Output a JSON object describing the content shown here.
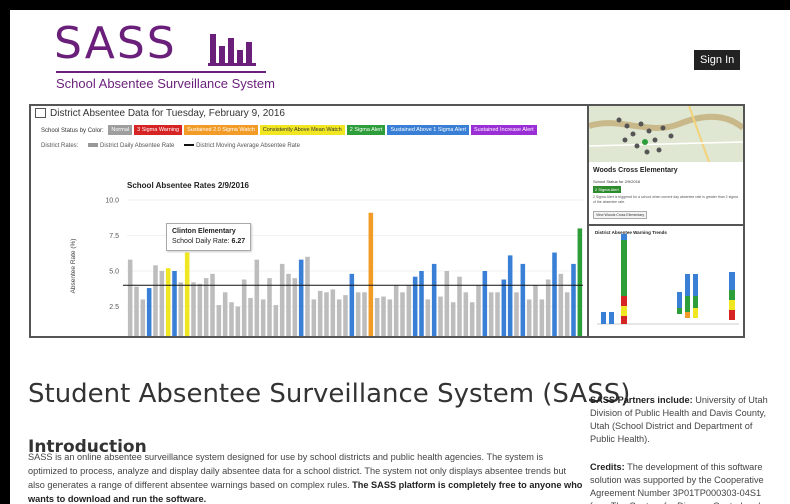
{
  "header": {
    "logo_word": "SASS",
    "logo_tagline": "School Absentee Surveillance System",
    "signin_label": "Sign In",
    "brand_color": "#6a1f7a"
  },
  "dashboard": {
    "title": "District Absentee Data for Tuesday, February 9, 2016",
    "status_label": "School Status by Color:",
    "statuses": [
      {
        "label": "Normal",
        "color": "#9e9e9e"
      },
      {
        "label": "3 Sigma Warning",
        "color": "#d62424"
      },
      {
        "label": "Sustained 2.0 Sigma Watch",
        "color": "#f29b26"
      },
      {
        "label": "Consistently Above Mean Watch",
        "color": "#f0e622"
      },
      {
        "label": "2 Sigma Alert",
        "color": "#2e9e3a"
      },
      {
        "label": "Sustained Above 1 Sigma Alert",
        "color": "#3a7fd6"
      },
      {
        "label": "Sustained Increase Alert",
        "color": "#9b2fd6"
      }
    ],
    "rates_label": "District Rates:",
    "rate_legend": [
      {
        "label": "District Daily Absentee Rate",
        "color": "#999999"
      },
      {
        "label": "District Moving Average Absentee Rate",
        "color": "#111111"
      }
    ],
    "tooltip": {
      "school": "Clinton Elementary",
      "label": "School Daily Rate:",
      "value": "6.27"
    },
    "map_panel": {
      "school": "Woods Cross Elementary",
      "status_line": "School Status for 2/9/2016",
      "badge": "2 Sigma Alert",
      "description": "2 Sigma Alert is triggered for a school when current day absentee rate is greater than 2 sigma of the absentee rate.",
      "button": "View Woods Cross Elementary"
    },
    "trends_panel": {
      "title": "District Absentee Warning Trends"
    }
  },
  "chart_data": {
    "type": "bar",
    "title": "School Absentee Rates 2/9/2016",
    "ylabel": "Absentee Rate (%)",
    "ylim": [
      0,
      10
    ],
    "yticks": [
      "0.0",
      "2.5",
      "5.0",
      "7.5",
      "10.0"
    ],
    "moving_average": 4.0,
    "values": [
      5.8,
      3.9,
      3.0,
      3.8,
      5.4,
      5.0,
      5.2,
      5.0,
      4.2,
      6.3,
      4.2,
      4.1,
      4.5,
      4.8,
      2.6,
      3.5,
      2.8,
      2.5,
      4.4,
      3.1,
      5.8,
      3.0,
      4.5,
      2.6,
      5.5,
      4.8,
      4.5,
      5.8,
      6.0,
      3.0,
      3.6,
      3.5,
      3.7,
      3.0,
      3.3,
      4.8,
      3.5,
      3.5,
      9.1,
      3.1,
      3.2,
      3.0,
      4.0,
      3.5,
      4.0,
      4.6,
      5.0,
      3.0,
      5.5,
      3.2,
      5.0,
      2.8,
      4.6,
      3.5,
      2.8,
      4.0,
      5.0,
      3.5,
      3.5,
      4.4,
      6.1,
      3.5,
      5.5,
      3.0,
      4.0,
      3.0,
      4.4,
      6.3,
      4.8,
      3.5,
      5.5,
      8.0
    ],
    "colors": [
      "#bdbdbd",
      "#bdbdbd",
      "#bdbdbd",
      "#3a7fd6",
      "#bdbdbd",
      "#bdbdbd",
      "#f0e622",
      "#3a7fd6",
      "#bdbdbd",
      "#f0e622",
      "#bdbdbd",
      "#bdbdbd",
      "#bdbdbd",
      "#bdbdbd",
      "#bdbdbd",
      "#bdbdbd",
      "#bdbdbd",
      "#bdbdbd",
      "#bdbdbd",
      "#bdbdbd",
      "#bdbdbd",
      "#bdbdbd",
      "#bdbdbd",
      "#bdbdbd",
      "#bdbdbd",
      "#bdbdbd",
      "#bdbdbd",
      "#3a7fd6",
      "#bdbdbd",
      "#bdbdbd",
      "#bdbdbd",
      "#bdbdbd",
      "#bdbdbd",
      "#bdbdbd",
      "#bdbdbd",
      "#3a7fd6",
      "#bdbdbd",
      "#bdbdbd",
      "#f29b26",
      "#bdbdbd",
      "#bdbdbd",
      "#bdbdbd",
      "#bdbdbd",
      "#bdbdbd",
      "#bdbdbd",
      "#3a7fd6",
      "#3a7fd6",
      "#bdbdbd",
      "#3a7fd6",
      "#bdbdbd",
      "#bdbdbd",
      "#bdbdbd",
      "#bdbdbd",
      "#bdbdbd",
      "#bdbdbd",
      "#bdbdbd",
      "#3a7fd6",
      "#bdbdbd",
      "#bdbdbd",
      "#3a7fd6",
      "#3a7fd6",
      "#bdbdbd",
      "#3a7fd6",
      "#bdbdbd",
      "#bdbdbd",
      "#bdbdbd",
      "#bdbdbd",
      "#3a7fd6",
      "#bdbdbd",
      "#bdbdbd",
      "#3a7fd6",
      "#2e9e3a"
    ]
  },
  "content": {
    "page_title": "Student Absentee Surveillance System (SASS)",
    "intro_heading": "Introduction",
    "intro_text": "SASS is an online absentee surveillance system designed for use by school districts and public health agencies. The system is optimized to process, analyze and display daily absentee data for a school district. The system not only displays absentee trends but also generates a range of different absentee warnings based on complex rules.",
    "intro_bold": "The SASS platform is completely free to anyone who wants to download and run the software.",
    "partners_label": "SASS Partners include:",
    "partners_text": "University of Utah Division of Public Health and Davis County, Utah (School District and Department of Public Health).",
    "credits_label": "Credits:",
    "credits_text": "The development of this software solution was supported by the Cooperative Agreement Number 3P01TP000303-04S1 from The Centers for Disease Control and"
  }
}
